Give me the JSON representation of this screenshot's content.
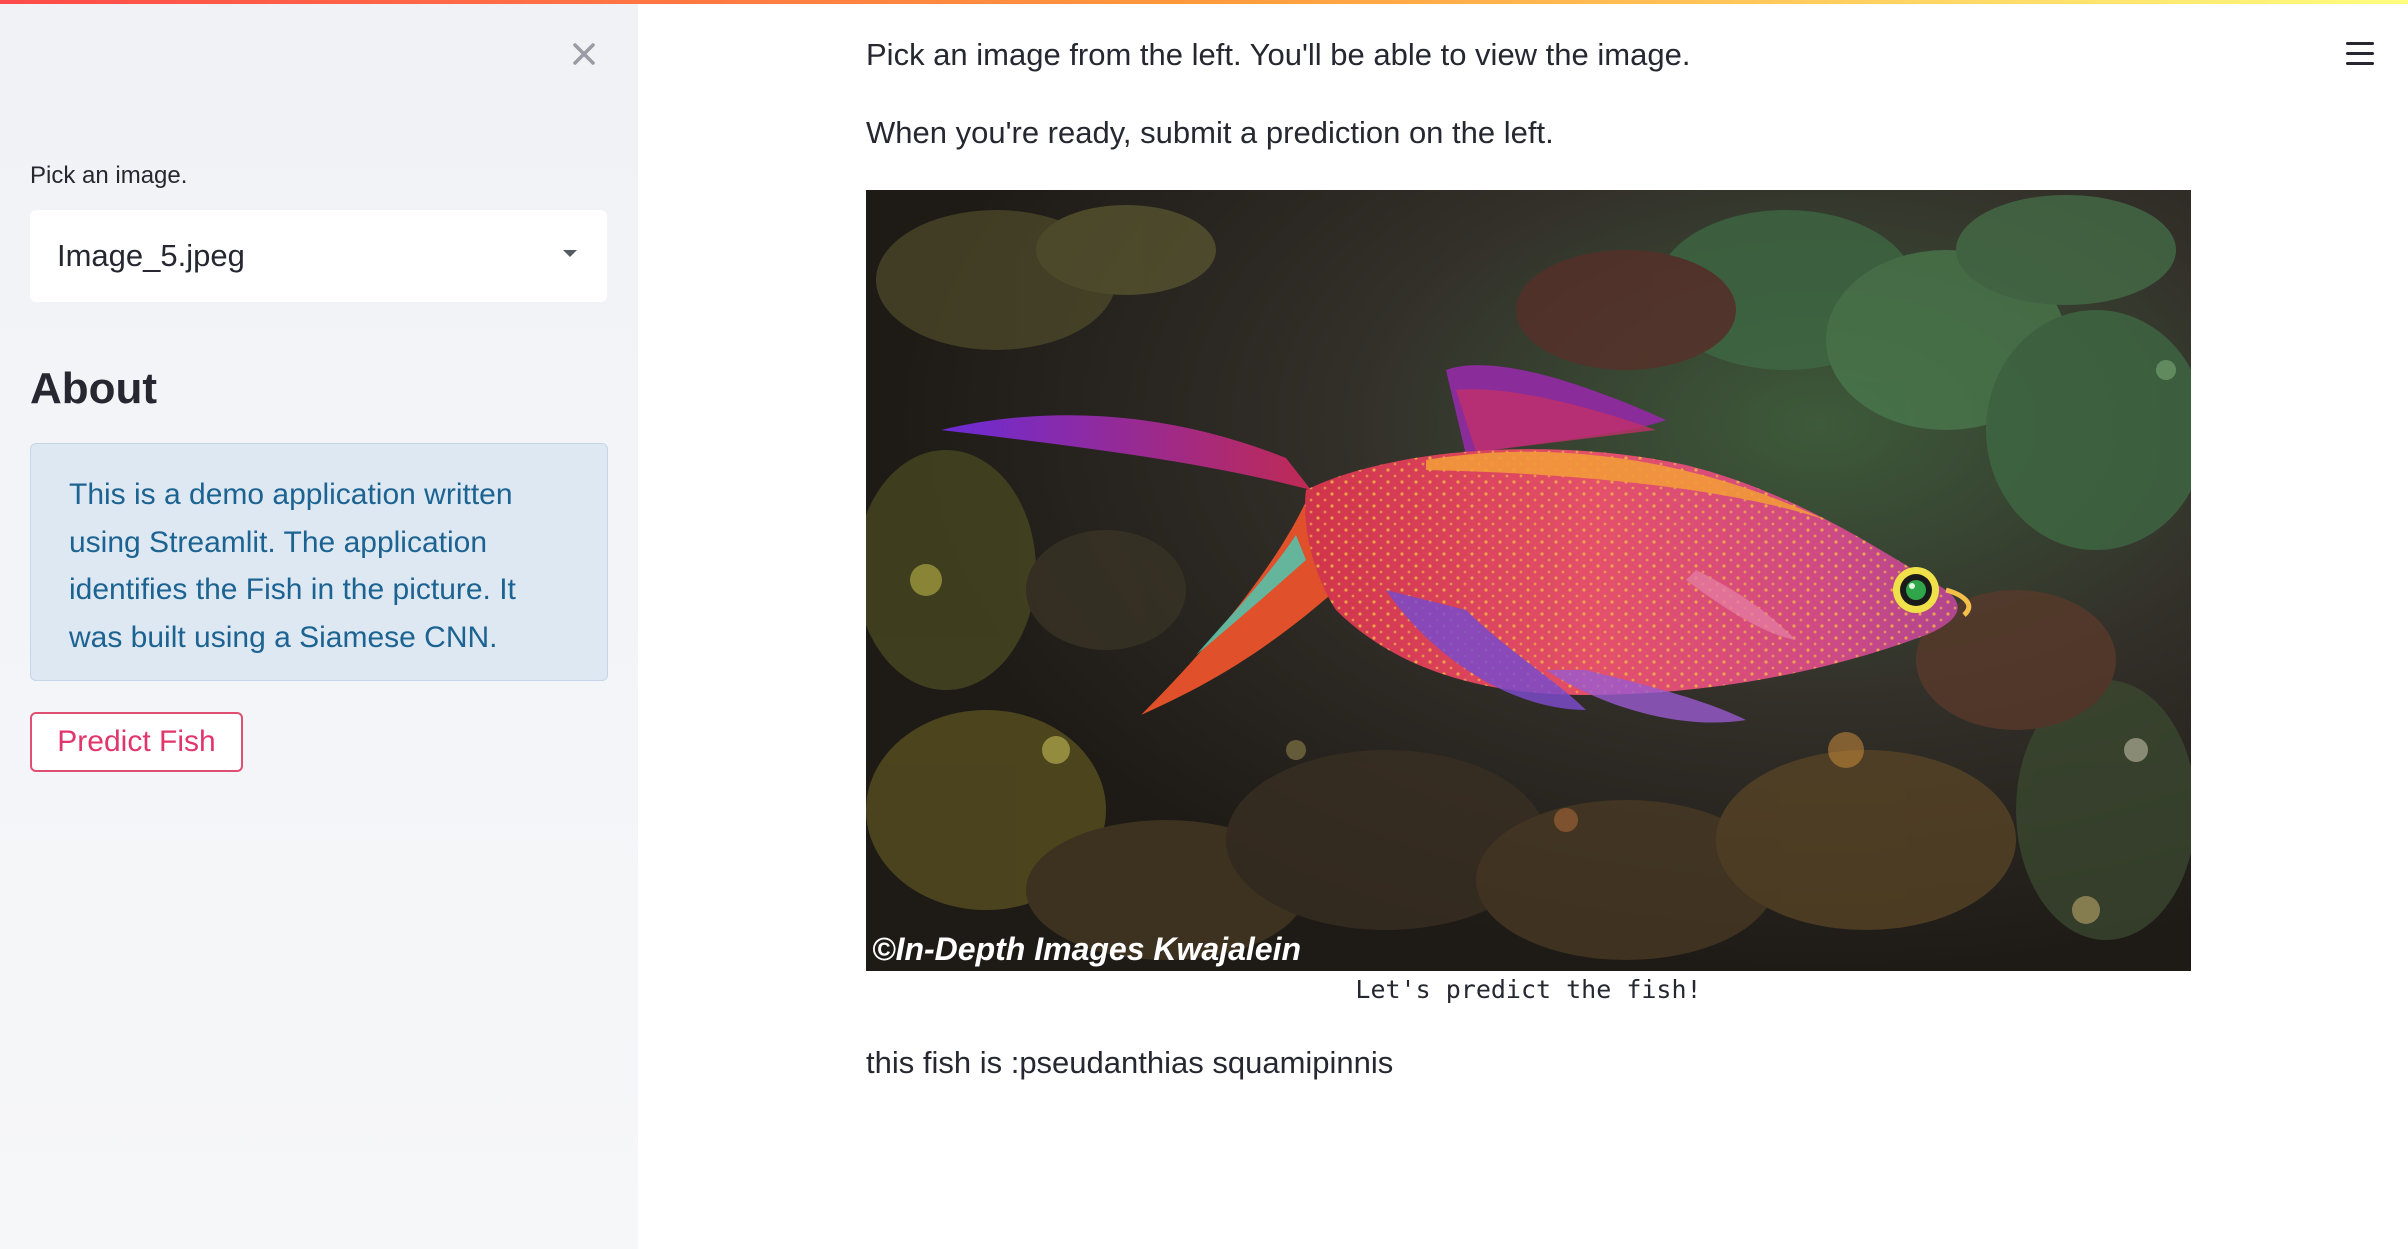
{
  "sidebar": {
    "select_label": "Pick an image.",
    "select_value": "Image_5.jpeg",
    "about_title": "About",
    "about_text": "This is a demo application written using Streamlit. The application identifies the Fish in the picture. It was built using a Siamese CNN.",
    "predict_button": "Predict Fish",
    "close_icon": "close-icon"
  },
  "main": {
    "intro_line_1": "Pick an image from the left. You'll be able to view the image.",
    "intro_line_2": "When you're ready, submit a prediction on the left.",
    "image_watermark": "©In-Depth Images Kwajalein",
    "image_caption": "Let's predict the fish!",
    "result_text": "this fish is :pseudanthias squamipinnis",
    "menu_icon": "hamburger-menu-icon"
  },
  "colors": {
    "sidebar_bg": "#f0f2f6",
    "info_bg": "#dde8f3",
    "info_text": "#1d6391",
    "accent": "#e0366b",
    "text": "#262730"
  }
}
